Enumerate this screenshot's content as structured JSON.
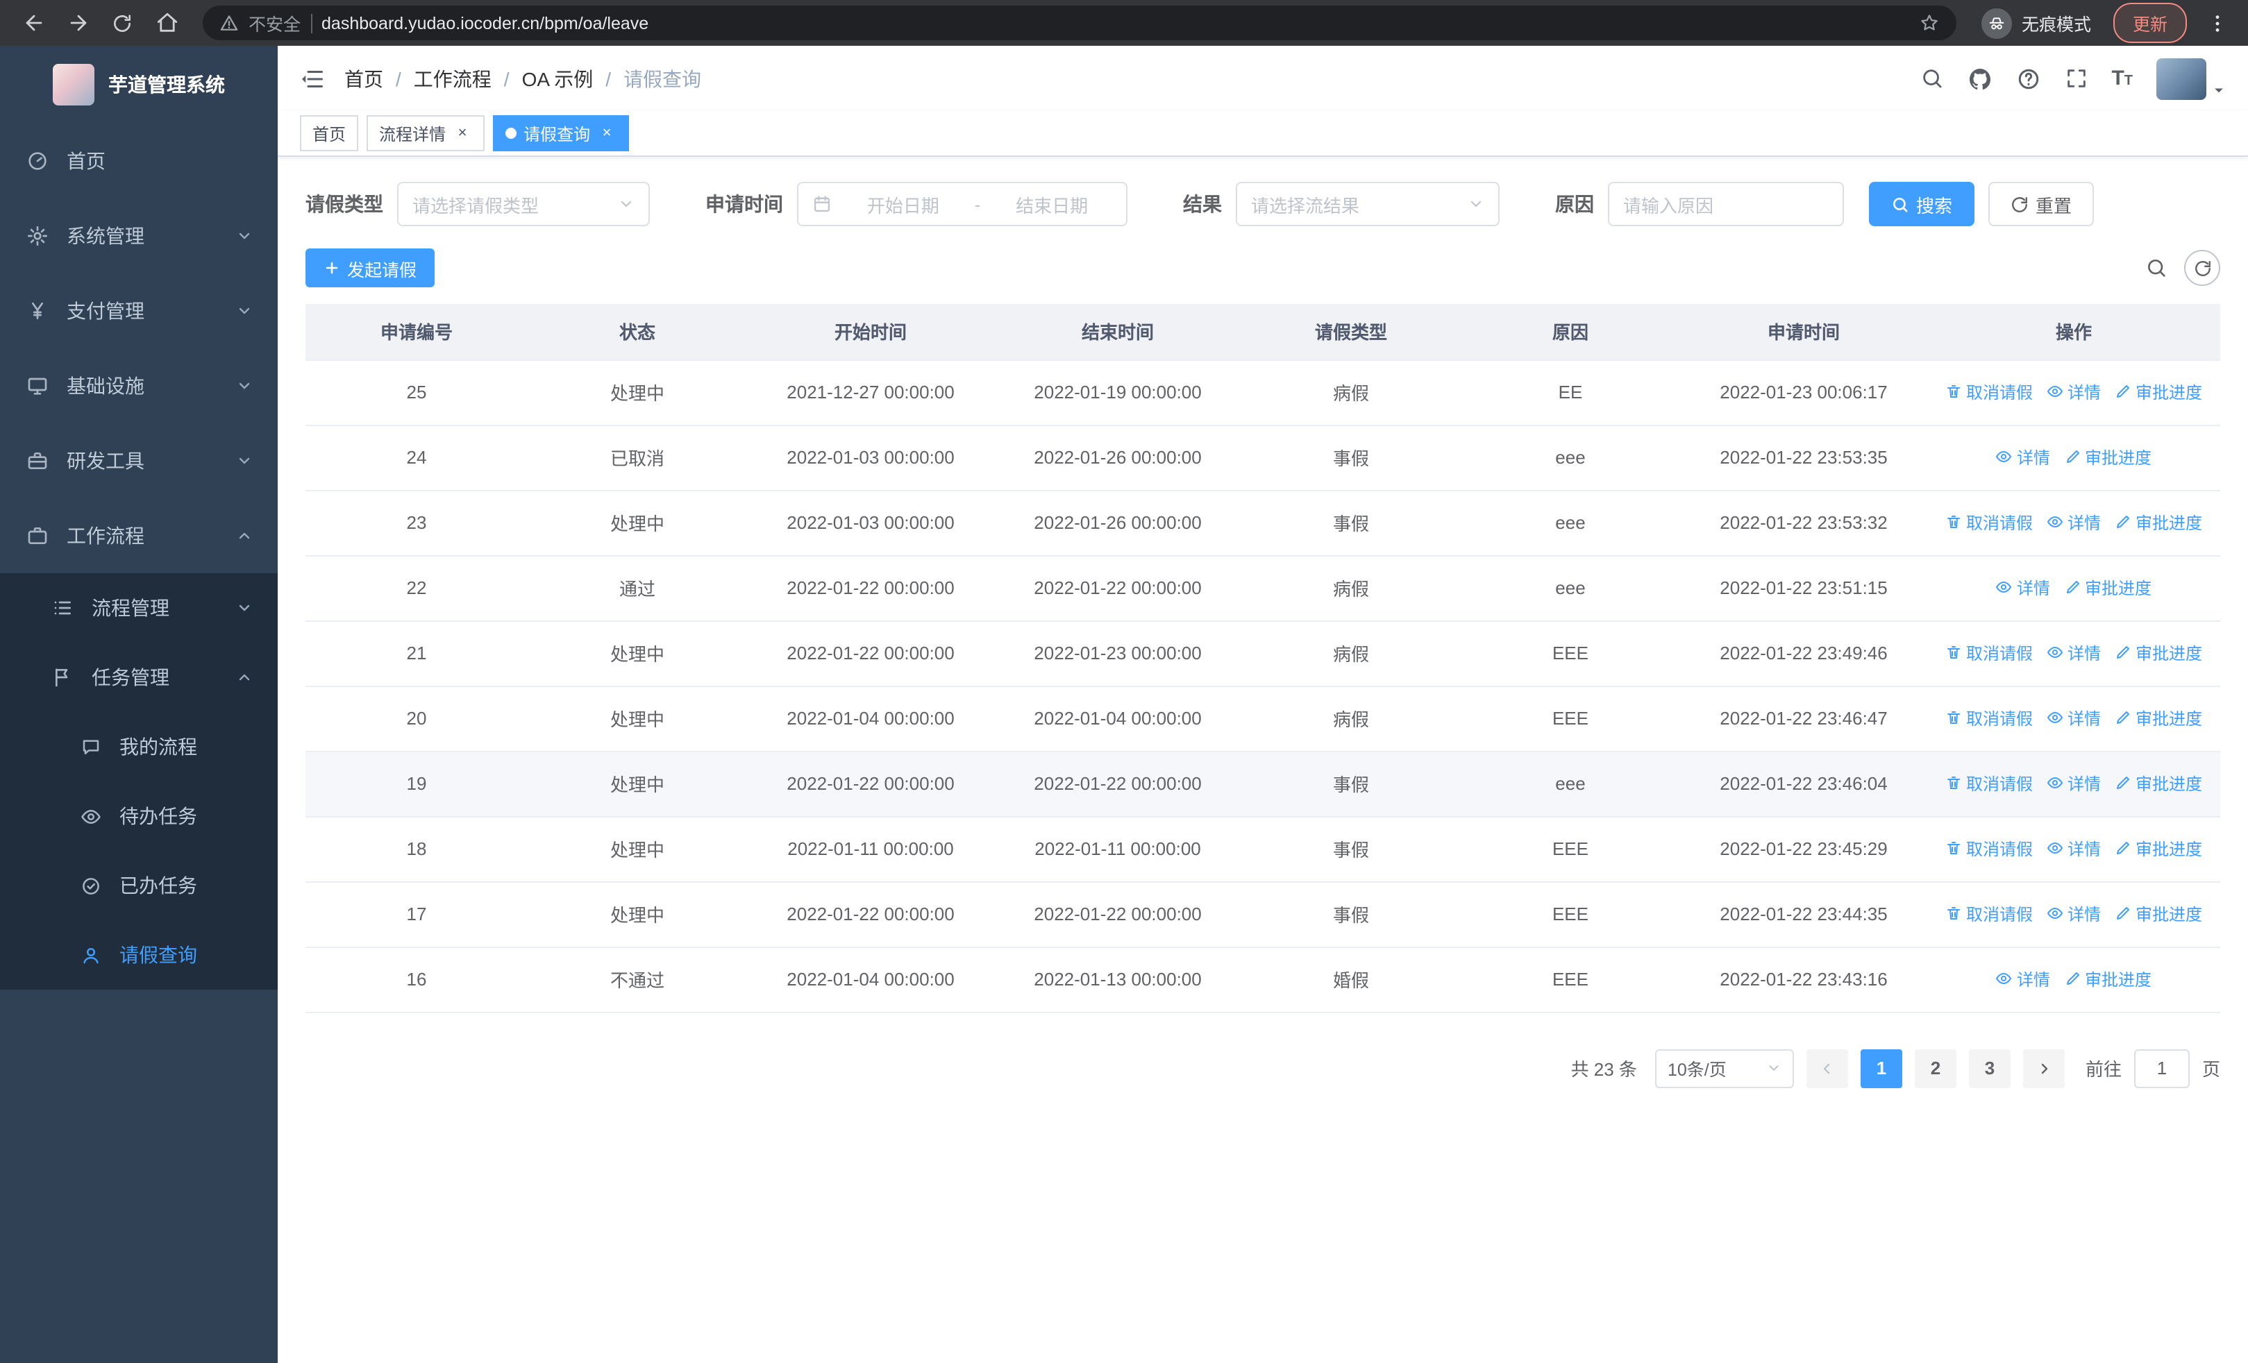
{
  "colors": {
    "primary": "#409eff",
    "sidebar_bg": "#304156",
    "submenu_bg": "#1f2d3d",
    "tab_active_bg": "#409eff"
  },
  "browser": {
    "security_label": "不安全",
    "url": "dashboard.yudao.iocoder.cn/bpm/oa/leave",
    "incognito_label": "无痕模式",
    "update_button": "更新"
  },
  "sidebar": {
    "logo_title": "芋道管理系统",
    "items": [
      {
        "label": "首页",
        "icon": "dashboard-icon"
      },
      {
        "label": "系统管理",
        "icon": "gear-icon",
        "chevron": "down"
      },
      {
        "label": "支付管理",
        "icon": "yen-icon",
        "chevron": "down"
      },
      {
        "label": "基础设施",
        "icon": "monitor-icon",
        "chevron": "down"
      },
      {
        "label": "研发工具",
        "icon": "toolbox-icon",
        "chevron": "down"
      },
      {
        "label": "工作流程",
        "icon": "briefcase-icon",
        "chevron": "up"
      }
    ],
    "workflow_children": [
      {
        "label": "流程管理",
        "icon": "list-icon",
        "chevron": "down"
      },
      {
        "label": "任务管理",
        "icon": "flag-icon",
        "chevron": "up"
      }
    ],
    "task_children": [
      {
        "label": "我的流程",
        "icon": "chat-bubble-icon"
      },
      {
        "label": "待办任务",
        "icon": "eye-icon"
      },
      {
        "label": "已办任务",
        "icon": "check-circle-icon"
      },
      {
        "label": "请假查询",
        "icon": "user-icon",
        "active": true
      }
    ]
  },
  "header": {
    "breadcrumb": [
      "首页",
      "工作流程",
      "OA 示例",
      "请假查询"
    ]
  },
  "tabs": [
    {
      "label": "首页",
      "closable": false,
      "active": false
    },
    {
      "label": "流程详情",
      "closable": true,
      "active": false
    },
    {
      "label": "请假查询",
      "closable": true,
      "active": true
    }
  ],
  "filters": {
    "leave_type_label": "请假类型",
    "leave_type_placeholder": "请选择请假类型",
    "apply_time_label": "申请时间",
    "date_start_placeholder": "开始日期",
    "date_separator": "-",
    "date_end_placeholder": "结束日期",
    "result_label": "结果",
    "result_placeholder": "请选择流结果",
    "reason_label": "原因",
    "reason_placeholder": "请输入原因",
    "search_button": "搜索",
    "reset_button": "重置"
  },
  "toolbar": {
    "create_button": "发起请假"
  },
  "table": {
    "columns": [
      "申请编号",
      "状态",
      "开始时间",
      "结束时间",
      "请假类型",
      "原因",
      "申请时间",
      "操作"
    ],
    "actions": {
      "cancel": "取消请假",
      "detail": "详情",
      "progress": "审批进度"
    },
    "rows": [
      {
        "id": "25",
        "status": "处理中",
        "start_time": "2021-12-27 00:00:00",
        "end_time": "2022-01-19 00:00:00",
        "leave_type": "病假",
        "reason": "EE",
        "apply_time": "2022-01-23 00:06:17",
        "cancellable": true,
        "highlighted": false
      },
      {
        "id": "24",
        "status": "已取消",
        "start_time": "2022-01-03 00:00:00",
        "end_time": "2022-01-26 00:00:00",
        "leave_type": "事假",
        "reason": "eee",
        "apply_time": "2022-01-22 23:53:35",
        "cancellable": false,
        "highlighted": false
      },
      {
        "id": "23",
        "status": "处理中",
        "start_time": "2022-01-03 00:00:00",
        "end_time": "2022-01-26 00:00:00",
        "leave_type": "事假",
        "reason": "eee",
        "apply_time": "2022-01-22 23:53:32",
        "cancellable": true,
        "highlighted": false
      },
      {
        "id": "22",
        "status": "通过",
        "start_time": "2022-01-22 00:00:00",
        "end_time": "2022-01-22 00:00:00",
        "leave_type": "病假",
        "reason": "eee",
        "apply_time": "2022-01-22 23:51:15",
        "cancellable": false,
        "highlighted": false
      },
      {
        "id": "21",
        "status": "处理中",
        "start_time": "2022-01-22 00:00:00",
        "end_time": "2022-01-23 00:00:00",
        "leave_type": "病假",
        "reason": "EEE",
        "apply_time": "2022-01-22 23:49:46",
        "cancellable": true,
        "highlighted": false
      },
      {
        "id": "20",
        "status": "处理中",
        "start_time": "2022-01-04 00:00:00",
        "end_time": "2022-01-04 00:00:00",
        "leave_type": "病假",
        "reason": "EEE",
        "apply_time": "2022-01-22 23:46:47",
        "cancellable": true,
        "highlighted": false
      },
      {
        "id": "19",
        "status": "处理中",
        "start_time": "2022-01-22 00:00:00",
        "end_time": "2022-01-22 00:00:00",
        "leave_type": "事假",
        "reason": "eee",
        "apply_time": "2022-01-22 23:46:04",
        "cancellable": true,
        "highlighted": true
      },
      {
        "id": "18",
        "status": "处理中",
        "start_time": "2022-01-11 00:00:00",
        "end_time": "2022-01-11 00:00:00",
        "leave_type": "事假",
        "reason": "EEE",
        "apply_time": "2022-01-22 23:45:29",
        "cancellable": true,
        "highlighted": false
      },
      {
        "id": "17",
        "status": "处理中",
        "start_time": "2022-01-22 00:00:00",
        "end_time": "2022-01-22 00:00:00",
        "leave_type": "事假",
        "reason": "EEE",
        "apply_time": "2022-01-22 23:44:35",
        "cancellable": true,
        "highlighted": false
      },
      {
        "id": "16",
        "status": "不通过",
        "start_time": "2022-01-04 00:00:00",
        "end_time": "2022-01-13 00:00:00",
        "leave_type": "婚假",
        "reason": "EEE",
        "apply_time": "2022-01-22 23:43:16",
        "cancellable": false,
        "highlighted": false
      }
    ]
  },
  "pagination": {
    "total": "共 23 条",
    "page_size": "10条/页",
    "pages": [
      "1",
      "2",
      "3"
    ],
    "active_page": "1",
    "goto_label": "前往",
    "goto_value": "1",
    "goto_unit": "页"
  }
}
